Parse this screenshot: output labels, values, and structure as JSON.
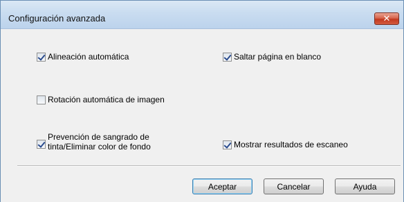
{
  "window": {
    "title": "Configuración avanzada",
    "close_label": "✕"
  },
  "options": {
    "auto_align": {
      "label": "Alineación automática",
      "checked": true
    },
    "skip_blank": {
      "label": "Saltar página en blanco",
      "checked": true
    },
    "auto_rotate": {
      "label": "Rotación automática de imagen",
      "checked": false
    },
    "bleed_line1": "Prevención de sangrado de",
    "bleed_line2": "tinta/Eliminar color de fondo",
    "bleed_checked": true,
    "show_results": {
      "label": "Mostrar resultados de escaneo",
      "checked": true
    }
  },
  "buttons": {
    "ok": "Aceptar",
    "cancel": "Cancelar",
    "help": "Ayuda"
  }
}
